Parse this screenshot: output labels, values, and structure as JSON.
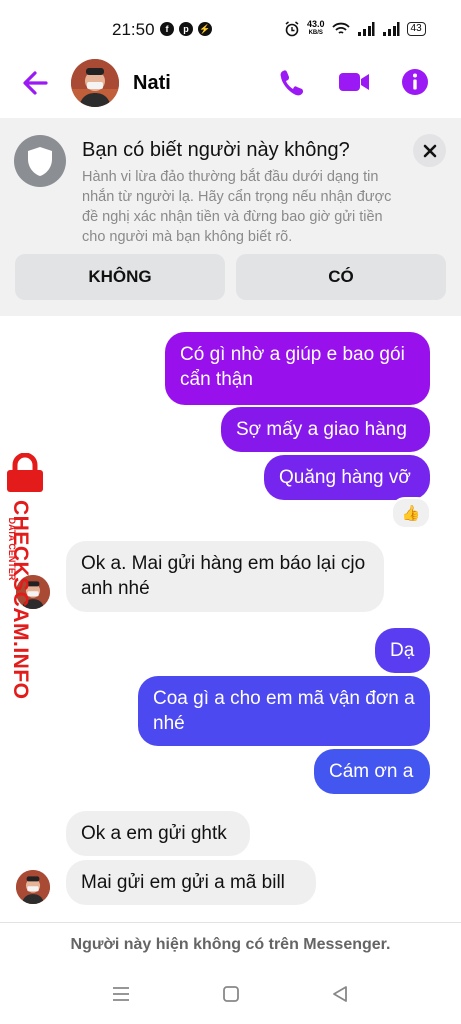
{
  "status": {
    "time": "21:50",
    "speed_value": "43.0",
    "speed_unit": "KB/S",
    "battery": "43"
  },
  "header": {
    "contact_name": "Nati"
  },
  "warning": {
    "title": "Bạn có biết người này không?",
    "body": "Hành vi lừa đảo thường bắt đầu dưới dạng tin nhắn từ người lạ. Hãy cẩn trọng nếu nhận được đề nghị xác nhận tiền và đừng bao giờ gửi tiền cho người mà bạn không biết rõ.",
    "no_label": "KHÔNG",
    "yes_label": "CÓ"
  },
  "messages": [
    {
      "side": "out",
      "text": "Có gì nhờ a giúp e bao gói cẩn thận"
    },
    {
      "side": "out",
      "text": "Sợ mấy a giao hàng"
    },
    {
      "side": "out",
      "text": "Quăng hàng vỡ"
    },
    {
      "side": "in",
      "text": "Ok a. Mai gửi hàng em báo lại cjo anh nhé"
    },
    {
      "side": "out",
      "text": "Dạ"
    },
    {
      "side": "out",
      "text": "Coa gì a cho em mã vận đơn a nhé"
    },
    {
      "side": "out",
      "text": "Cám ơn a"
    },
    {
      "side": "in",
      "text": "Ok a em gửi ghtk"
    },
    {
      "side": "in",
      "text": "Mai gửi em gửi a mã bill"
    }
  ],
  "reaction": {
    "emoji": "👍"
  },
  "watermark": {
    "main": "CHECKSCAM.INFO",
    "sub": "DATA CENTER"
  },
  "footer": {
    "notice": "Người này hiện không có trên Messenger."
  },
  "colors": {
    "accent": "#9b19f5",
    "bubble_top": "#9a10e8",
    "bubble_bottom": "#4b4ff0",
    "warning_bg": "#f1f1f2"
  }
}
